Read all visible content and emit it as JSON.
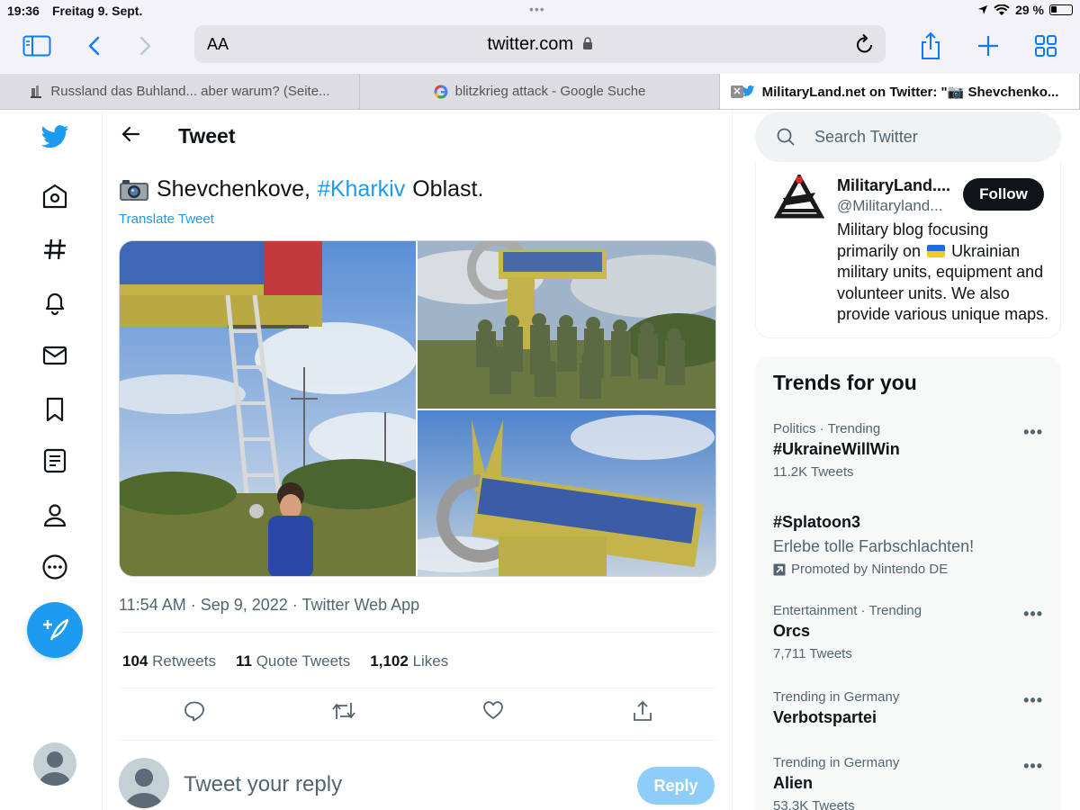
{
  "status_bar": {
    "time": "19:36",
    "date": "Freitag 9. Sept.",
    "battery": "29 %"
  },
  "browser": {
    "text_size_label": "AA",
    "url": "twitter.com",
    "tabs": [
      {
        "title": "Russland das Buhland... aber warum? (Seite..."
      },
      {
        "title": "blitzkrieg attack - Google Suche"
      },
      {
        "title": "MilitaryLand.net on Twitter: \"📷 Shevchenko..."
      }
    ]
  },
  "header": {
    "title": "Tweet"
  },
  "tweet": {
    "text_before": "Shevchenkove,",
    "hashtag": "#Kharkiv",
    "text_after": "Oblast.",
    "translate": "Translate Tweet",
    "meta": "11:54 AM · Sep 9, 2022 · Twitter Web App",
    "stats": {
      "retweets_count": "104",
      "retweets_label": "Retweets",
      "quotes_count": "11",
      "quotes_label": "Quote Tweets",
      "likes_count": "1,102",
      "likes_label": "Likes"
    },
    "reply_placeholder": "Tweet your reply",
    "reply_button": "Reply"
  },
  "search": {
    "placeholder": "Search Twitter"
  },
  "profile": {
    "name": "MilitaryLand....",
    "handle": "@Militaryland...",
    "follow": "Follow",
    "bio_before": "Military blog focusing primarily on",
    "bio_after": "Ukrainian military units, equipment and volunteer units. We also provide various unique maps."
  },
  "trends": {
    "title": "Trends for you",
    "items": [
      {
        "context": "Politics · Trending",
        "name": "#UkraineWillWin",
        "count": "11.2K Tweets"
      },
      {
        "context": "",
        "name": "#Splatoon3",
        "description": "Erlebe tolle Farbschlachten!",
        "promoted": "Promoted by Nintendo DE"
      },
      {
        "context": "Entertainment · Trending",
        "name": "Orcs",
        "count": "7,711 Tweets"
      },
      {
        "context": "Trending in Germany",
        "name": "Verbotspartei"
      },
      {
        "context": "Trending in Germany",
        "name": "Alien",
        "count": "53.3K Tweets"
      }
    ]
  },
  "colors": {
    "accent": "#1d9bf0",
    "safari_blue": "#0a7aff",
    "text": "#0f1419",
    "muted": "#536471"
  }
}
